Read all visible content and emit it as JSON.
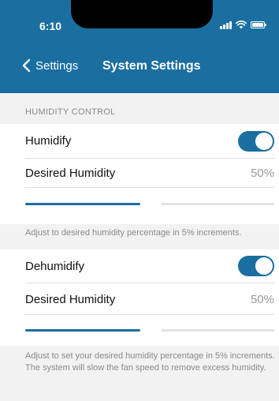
{
  "status_bar": {
    "time": "6:10"
  },
  "nav": {
    "back_label": "Settings",
    "title": "System Settings"
  },
  "humidity_control": {
    "section_title": "HUMIDITY CONTROL",
    "humidify": {
      "label": "Humidify",
      "enabled": true
    },
    "humidify_level": {
      "label": "Desired Humidity",
      "value": "50%",
      "slider_fraction": 0.5
    },
    "humidify_note": "Adjust to desired humidity percentage in 5% increments.",
    "dehumidify": {
      "label": "Dehumidify",
      "enabled": true
    },
    "dehumidify_level": {
      "label": "Desired Humidity",
      "value": "50%",
      "slider_fraction": 0.5
    },
    "dehumidify_note": "Adjust to set your desired humidity percentage in 5% increments. The system will slow the fan speed to remove excess humidity."
  },
  "colors": {
    "accent": "#1a6fa0",
    "background": "#f2f2f2",
    "secondary_text": "#8a8a8a"
  }
}
